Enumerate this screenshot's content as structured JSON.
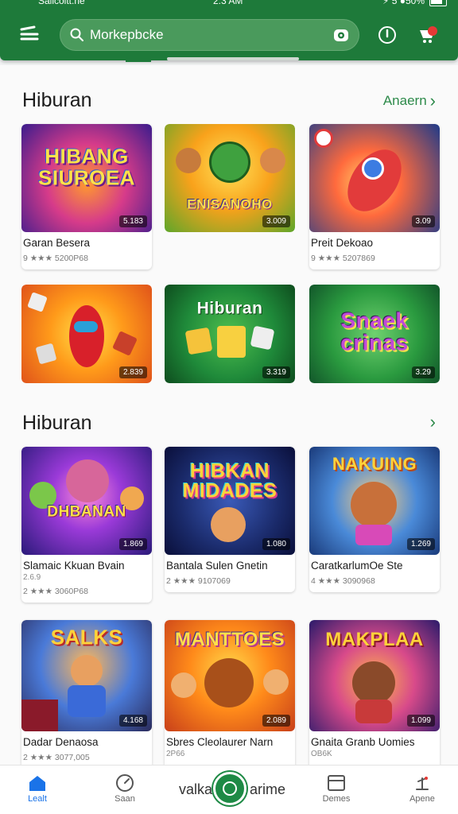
{
  "status": {
    "left": "Saiicoltt.ne",
    "time": "2.3 AM",
    "right": "⚡ 5 ●50%"
  },
  "search": {
    "value": "Morkepbcke"
  },
  "sections": [
    {
      "title": "Hiburan",
      "more": "Anaern",
      "cards": [
        {
          "thumb_title": "HIBANG SIUROEA",
          "badge": "5.183",
          "name": "Garan Besera",
          "sub": "",
          "meta": "9 ★★★ 5200P68"
        },
        {
          "thumb_title": "ENISANOHO",
          "badge": "3.009",
          "name": "",
          "sub": "",
          "meta": ""
        },
        {
          "thumb_title": "",
          "badge": "3.09",
          "name": "Preit Dekoao",
          "sub": "",
          "meta": "9 ★★★ 5207869"
        },
        {
          "thumb_title": "",
          "badge": "2.839",
          "name": "",
          "sub": "",
          "meta": ""
        },
        {
          "thumb_title": "Hiburan",
          "badge": "3.319",
          "name": "",
          "sub": "",
          "meta": ""
        },
        {
          "thumb_title": "Snaek crinas",
          "badge": "3.29",
          "name": "",
          "sub": "",
          "meta": ""
        }
      ]
    },
    {
      "title": "Hiburan",
      "more": "",
      "cards": [
        {
          "thumb_title": "DHBANAN",
          "badge": "1.869",
          "name": "Slamaic Kkuan Bvain",
          "sub": "2.6.9 ",
          "meta": "2 ★★★ 3060P68"
        },
        {
          "thumb_title": "HIBKAN MIDADES",
          "badge": "1.080",
          "name": "Bantala Sulen Gnetin",
          "sub": "",
          "meta": "2 ★★★ 9107069"
        },
        {
          "thumb_title": "NAKUING",
          "badge": "1.269",
          "name": "CaratkarlumOe Ste",
          "sub": "",
          "meta": "4 ★★★ 3090968"
        },
        {
          "thumb_title": "SALKS",
          "badge": "4.168",
          "name": "Dadar Denaosa",
          "sub": "",
          "meta": "2 ★★★ 3077,005"
        },
        {
          "thumb_title": "MANTTOES",
          "badge": "2.089",
          "name": "Sbres Cleolaurer Narn",
          "sub": "2P66",
          "meta": ""
        },
        {
          "thumb_title": "MAKPLAA",
          "badge": "1.099",
          "name": "Gnaita Granb Uomies",
          "sub": "OB6K",
          "meta": ""
        }
      ]
    }
  ],
  "nav": [
    {
      "label": "Lealt",
      "icon": "home-icon"
    },
    {
      "label": "Saan",
      "icon": "compass-icon"
    },
    {
      "label": "Demes",
      "icon": "library-icon"
    },
    {
      "label": "Apene",
      "icon": "apps-icon"
    }
  ],
  "nav_center": "valkarnore arime",
  "colors": {
    "brand": "#1e7a3a",
    "accent": "#2d8a4a",
    "active": "#1a73e8"
  }
}
